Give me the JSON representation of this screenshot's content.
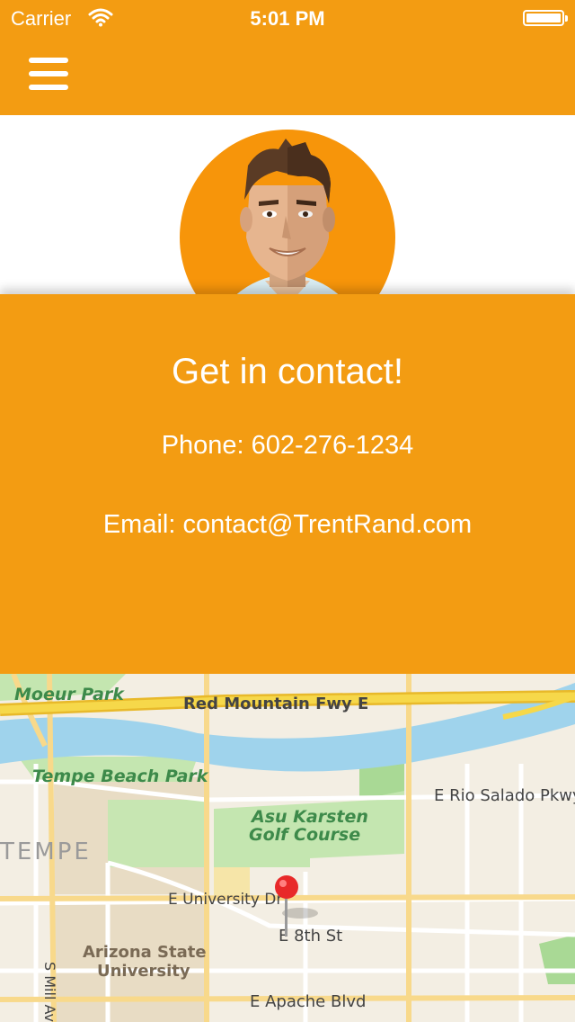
{
  "status_bar": {
    "carrier": "Carrier",
    "time": "5:01 PM",
    "wifi_icon": "wifi-icon",
    "battery_icon": "battery-icon"
  },
  "nav": {
    "menu_icon": "hamburger-menu-icon",
    "background_color": "#f39c12"
  },
  "profile": {
    "avatar_icon": "avatar-illustration",
    "avatar_bg_color": "#f7950a"
  },
  "contact": {
    "title": "Get in contact!",
    "phone": "Phone: 602-276-1234",
    "email": "Email: contact@TrentRand.com"
  },
  "map": {
    "labels": {
      "moeur_park": "Moeur Park",
      "red_mountain": "Red Mountain Fwy E",
      "tempe_beach_park": "Tempe Beach Park",
      "rio_salado": "E Rio Salado Pkwy",
      "asu_karsten_1": "Asu Karsten",
      "asu_karsten_2": "Golf Course",
      "tempe": "TEMPE",
      "university": "E University Dr",
      "eighth_st": "E 8th St",
      "asu_1": "Arizona State",
      "asu_2": "University",
      "mill_ave": "S Mill Ave",
      "apache": "E Apache Blvd"
    },
    "pin_icon": "map-pin-icon",
    "water_color": "#9fd3ec",
    "park_color": "#c4e6b0",
    "highway_color": "#f6d84a"
  }
}
